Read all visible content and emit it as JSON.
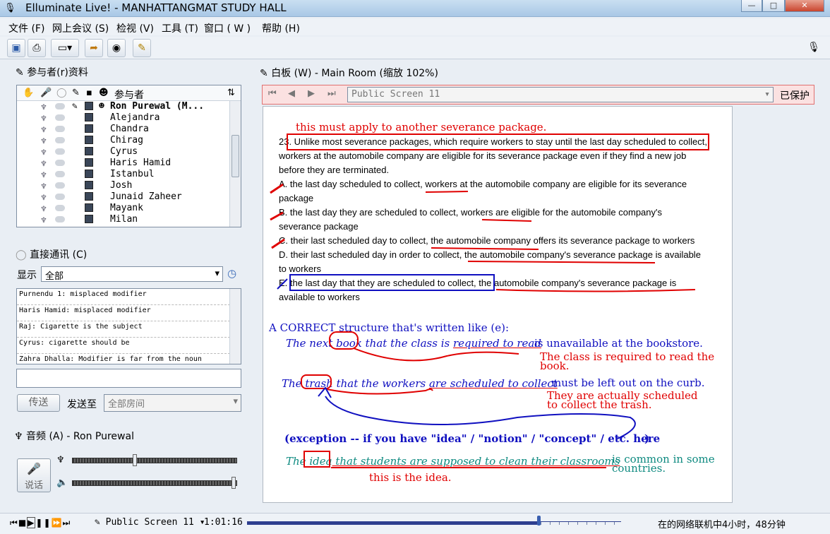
{
  "window": {
    "title": "Elluminate Live! - MANHATTANGMAT STUDY HALL",
    "min": "—",
    "max": "□",
    "close": "✕"
  },
  "menu": [
    "文件 (F)",
    "网上会议 (S)",
    "检视 (V)",
    "工具 (T)",
    "窗口 ( W )",
    "帮助 (H)"
  ],
  "participants": {
    "title": "参与者(r)资料",
    "header": "参与者",
    "sort_icon": "⇅",
    "names": [
      "Ron Purewal (M...",
      "Alejandra",
      "Chandra",
      "Chirag",
      "Cyrus",
      "Haris Hamid",
      "Istanbul",
      "Josh",
      "Junaid Zaheer",
      "Mayank",
      "Milan"
    ]
  },
  "chat": {
    "title": "直接通讯 (C)",
    "show_label": "显示",
    "show_value": "全部",
    "messages": [
      "Purnendu 1: misplaced modifier",
      "Haris Hamid: misplaced modifier",
      "Raj: Cigarette is the subject",
      "Cyrus: cigarette should be",
      "Zahra Dhalla: Modifier is far from the noun"
    ],
    "input_value": "",
    "send_label": "传送",
    "send_to_label": "发送至",
    "send_to_value": "全部房间"
  },
  "audio": {
    "title": "音频 (A) - Ron Purewal",
    "talk_label": "说话",
    "mic_level": 0.38,
    "speaker_level": 0.98
  },
  "whiteboard": {
    "title": "白板 (W) - Main Room (缩放 102%)",
    "screen": "Public Screen 11",
    "protected_label": "已保护",
    "notes": {
      "apply": "this must apply to another severance package.",
      "correct": "A CORRECT structure that's written like (e):",
      "ex1_pre": "The next ",
      "ex1_book": "book",
      "ex1_mid": " that the class is ",
      "ex1_req": "required to read",
      "ex1_post": "is unavailable at the bookstore.",
      "ex1_note1": "The class is required to read the",
      "ex1_note2": "book.",
      "ex2_pre": "The ",
      "ex2_trash": "trash",
      "ex2_mid": " that the workers ",
      "ex2_sched": "are scheduled to collect",
      "ex2_post": "must be left out on the curb.",
      "ex2_note1": "They are actually scheduled",
      "ex2_note2": "to collect the trash.",
      "exception": "(exception -- if you have \"idea\" / \"notion\" / \"concept\" / etc. here",
      "exception_end": ")",
      "ex3_pre": "The ",
      "ex3_idea": "idea",
      "ex3_mid": " that students are supposed to clean their classrooms",
      "ex3_post1": "is common in some",
      "ex3_post2": "countries.",
      "idea_note": "this is the idea."
    },
    "question": [
      "23. Unlike most severance packages, which require workers to stay until the last day scheduled to collect,",
      "workers at the automobile company are eligible for its severance package even if they find a new job",
      "before they are terminated.",
      "A. the last day scheduled to collect, workers at the automobile company are eligible for its severance",
      "package",
      "B. the last day they are scheduled to collect, workers are eligible for the automobile company's",
      "severance package",
      "C. their last scheduled day to collect, the automobile company offers its severance package to workers",
      "D. their last scheduled day in order to collect, the automobile company's severance package is available",
      "to workers",
      "E. the last day that they are scheduled to collect, the automobile company's severance package is",
      "available to workers"
    ]
  },
  "status": {
    "screen": "Public Screen 11",
    "time": "1:01:16",
    "message": "在的网络联机中4小时，48分钟",
    "progress": 0.78
  },
  "colors": {
    "red": "#e00000",
    "blue": "#1010c0",
    "teal": "#0e8a80"
  }
}
